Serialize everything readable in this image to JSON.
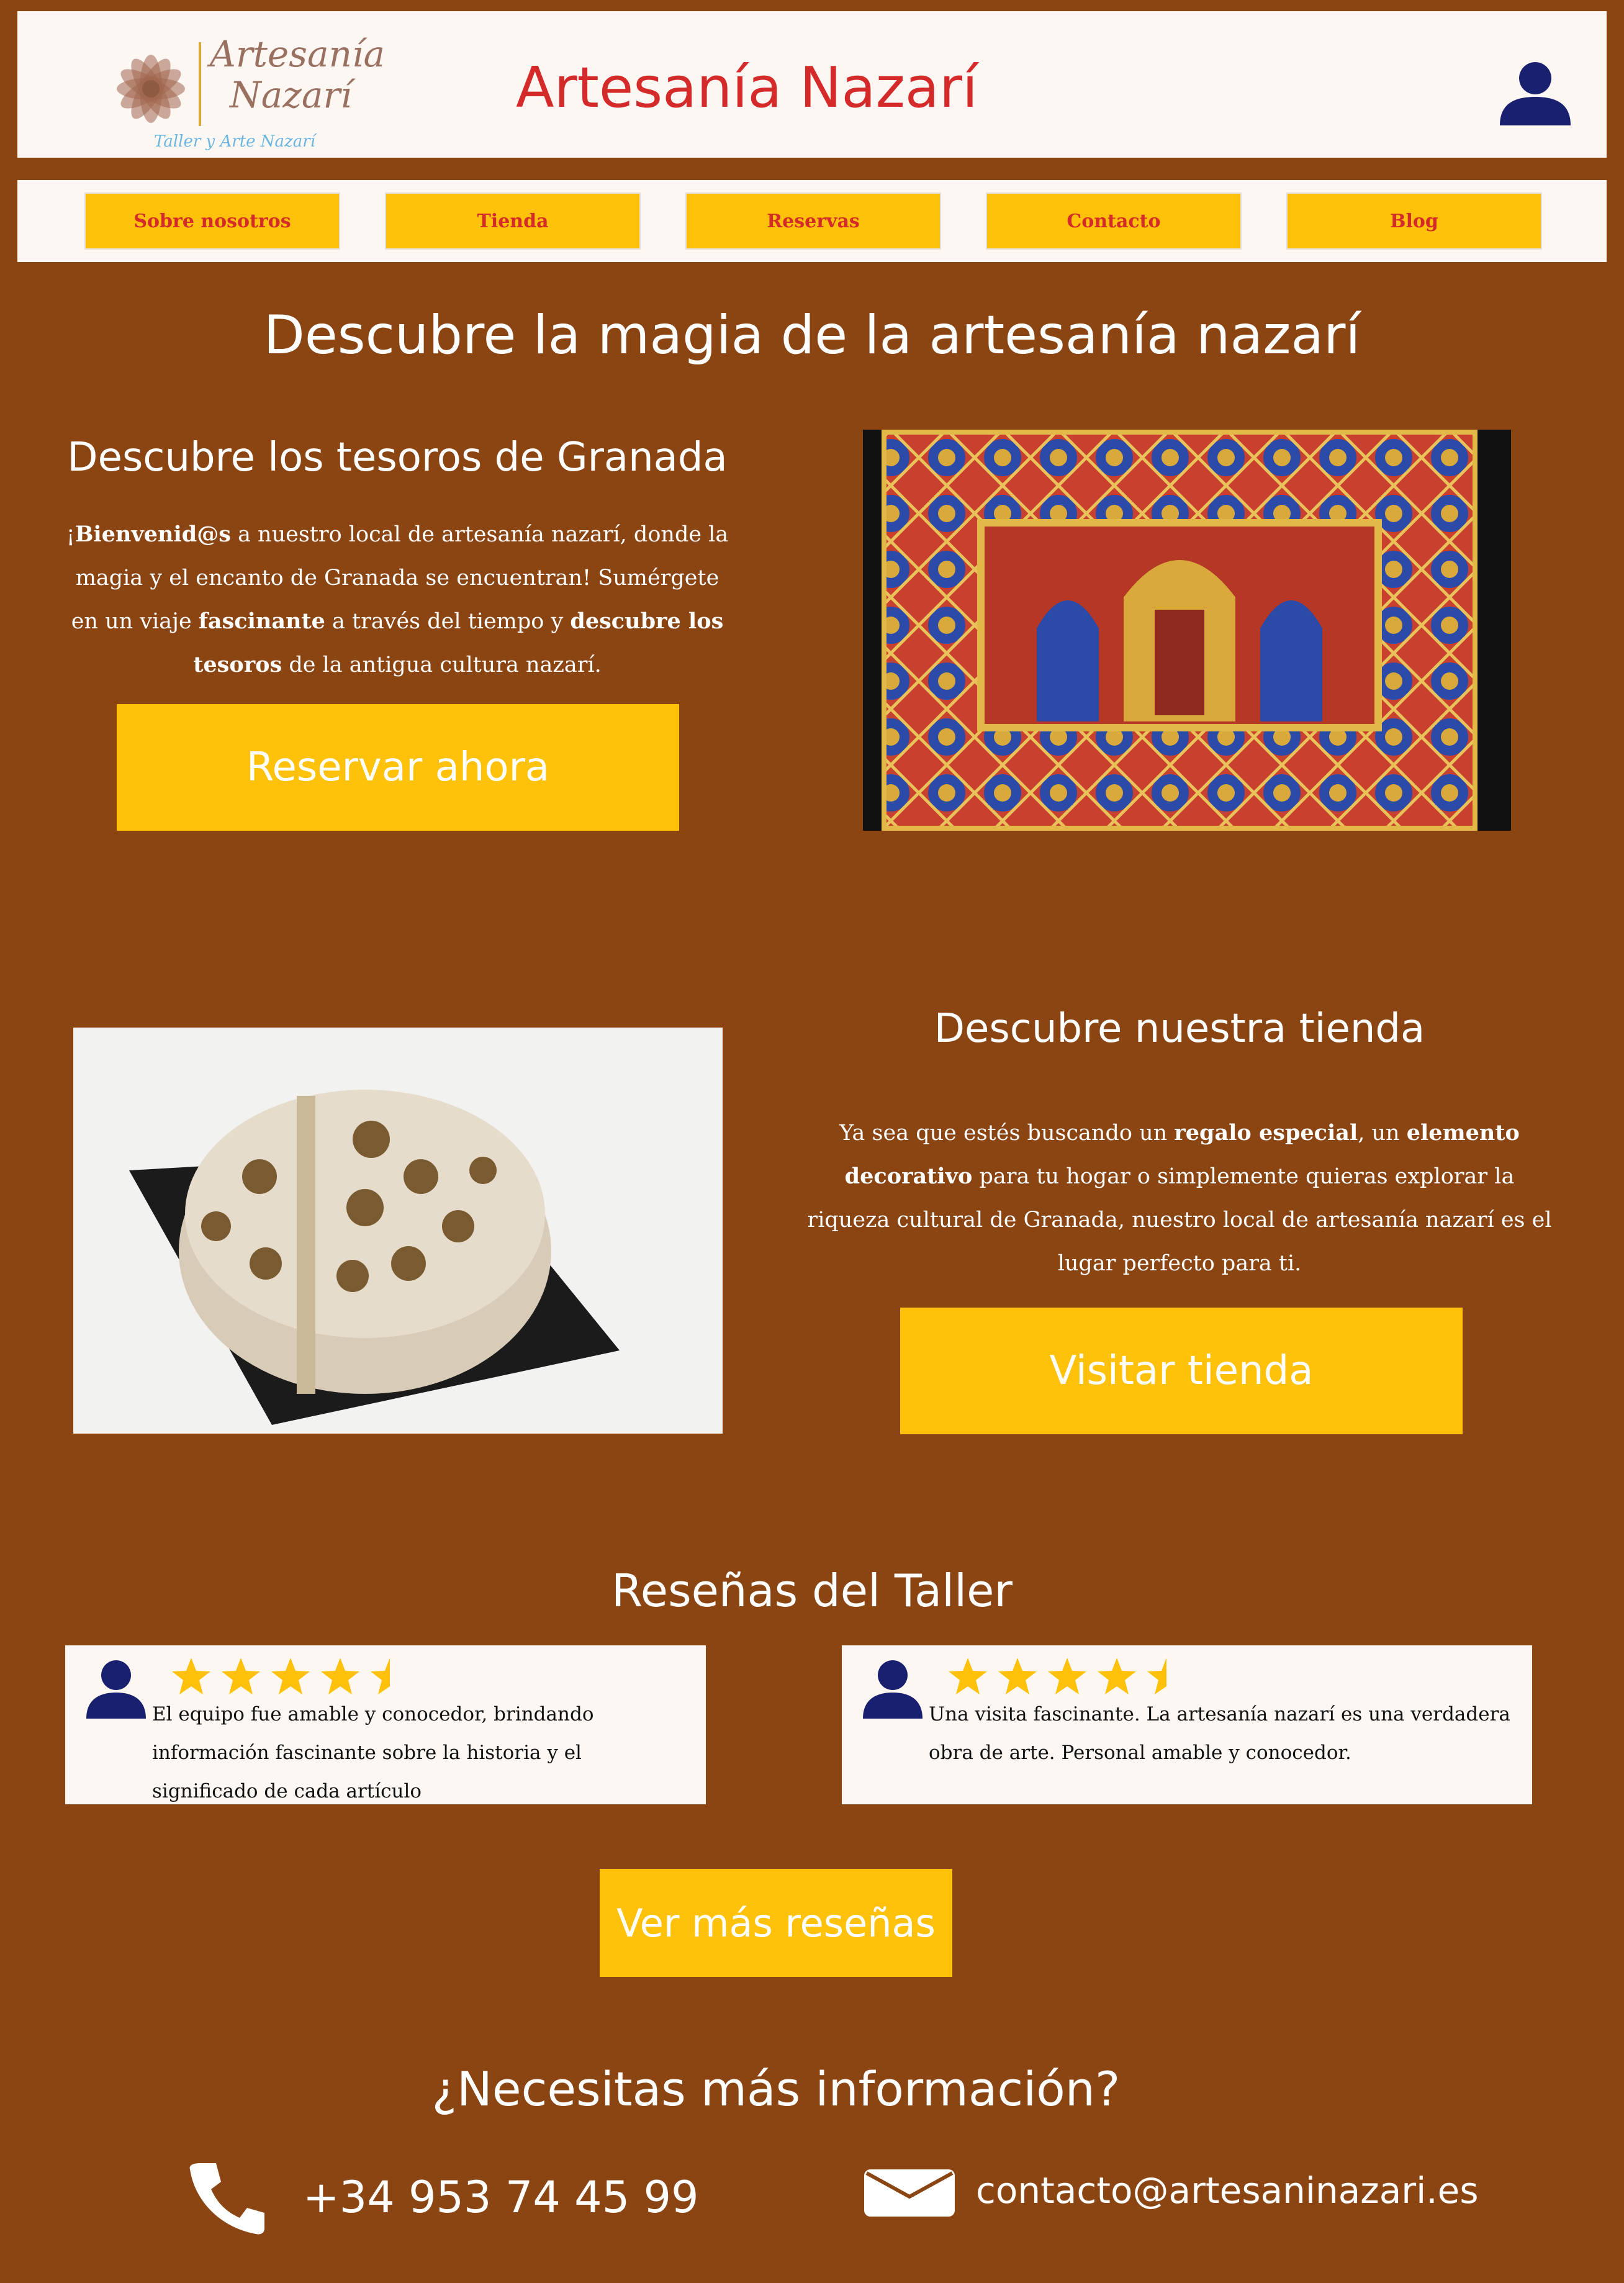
{
  "header": {
    "logo_line1": "Artesanía",
    "logo_line2": "Nazarí",
    "logo_tagline": "Taller y Arte Nazarí",
    "site_title": "Artesanía Nazarí",
    "user_icon": "user-icon"
  },
  "nav": {
    "items": [
      {
        "label": "Sobre nosotros"
      },
      {
        "label": "Tienda"
      },
      {
        "label": "Reservas"
      },
      {
        "label": "Contacto"
      },
      {
        "label": "Blog"
      }
    ]
  },
  "hero": {
    "title": "Descubre la magia de la artesanía nazarí"
  },
  "section1": {
    "title": "Descubre los tesoros de Granada",
    "p_open": "¡",
    "p_b1": "Bienvenid@s",
    "p_t1": " a nuestro local de artesanía nazarí, donde la magia y el encanto de Granada se encuentran! Sumérgete en un viaje ",
    "p_b2": "fascinante",
    "p_t2": " a través del tiempo y ",
    "p_b3": "descubre los tesoros",
    "p_t3": " de la antigua cultura nazarí.",
    "button": "Reservar ahora"
  },
  "section2": {
    "title": "Descubre nuestra tienda",
    "p_t1": "Ya sea que estés buscando un ",
    "p_b1": "regalo especial",
    "p_t2": ", un ",
    "p_b2": "elemento decorativo",
    "p_t3": " para tu hogar o simplemente quieras explorar la riqueza cultural de Granada, nuestro local de artesanía nazarí es el lugar perfecto para ti.",
    "button": "Visitar tienda"
  },
  "reviews": {
    "title": "Reseñas del Taller",
    "items": [
      {
        "rating": 4.5,
        "text": "El equipo fue amable y conocedor, brindando información fascinante sobre la historia y el significado de cada artículo"
      },
      {
        "rating": 4.5,
        "text": "Una visita fascinante. La artesanía nazarí es una verdadera obra de arte. Personal amable y conocedor."
      }
    ],
    "button": "Ver más reseñas"
  },
  "contact": {
    "title": "¿Necesitas más información?",
    "phone": "+34 953 74 45 99",
    "email": "contacto@artesaninazari.es"
  },
  "colors": {
    "background": "#8b4513",
    "accent": "#ffc10a",
    "title_red": "#d42a2a",
    "panel": "#fdf7f3",
    "icon_navy": "#1a2070"
  }
}
